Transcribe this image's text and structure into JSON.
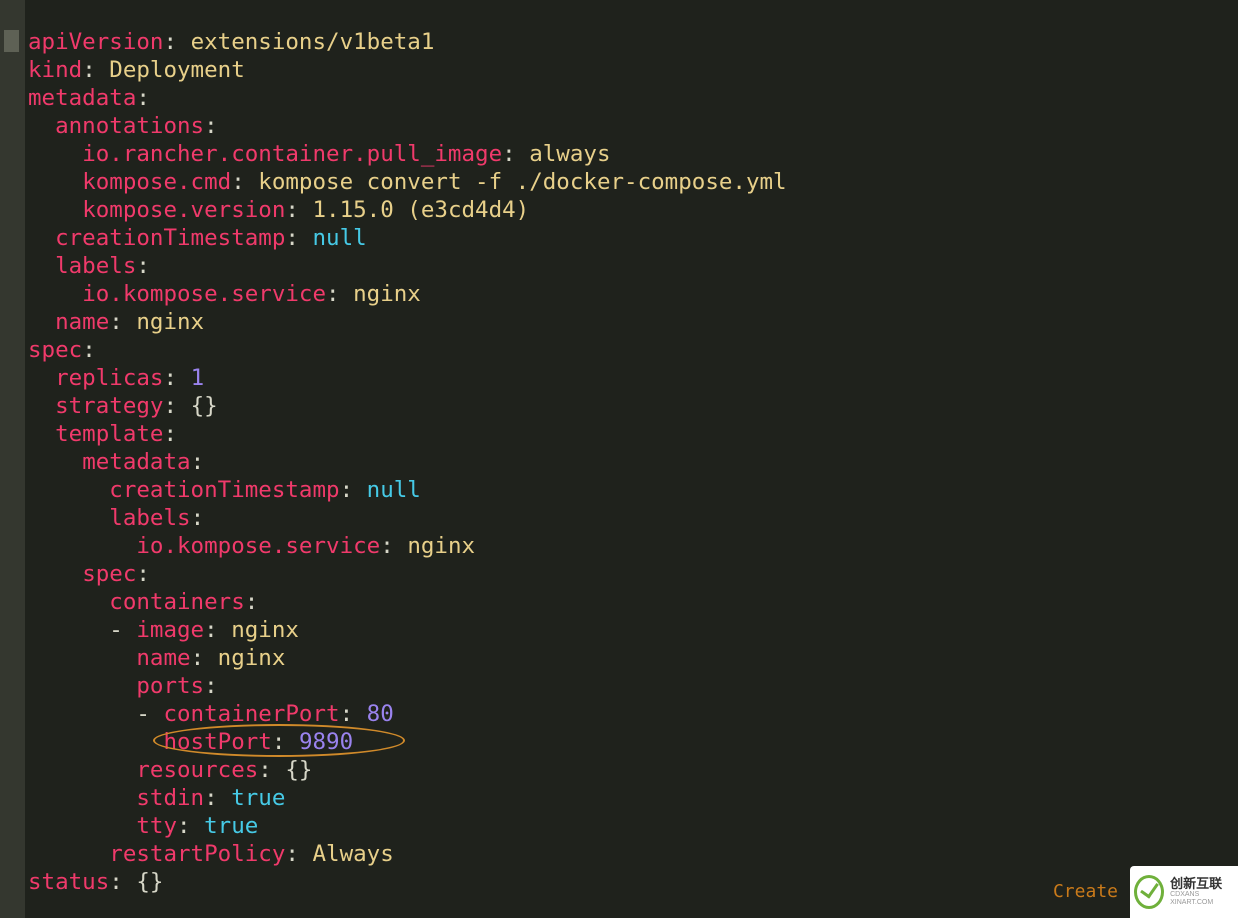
{
  "code": {
    "apiVersion_key": "apiVersion",
    "apiVersion_val": "extensions/v1beta1",
    "kind_key": "kind",
    "kind_val": "Deployment",
    "metadata_key": "metadata",
    "annotations_key": "annotations",
    "anno1_key": "io.rancher.container.pull_image",
    "anno1_val": "always",
    "anno2_key": "kompose.cmd",
    "anno2_val": "kompose convert -f ./docker-compose.yml",
    "anno3_key": "kompose.version",
    "anno3_val": "1.15.0 (e3cd4d4)",
    "creationTimestamp_key": "creationTimestamp",
    "creationTimestamp_val": "null",
    "labels_key": "labels",
    "label1_key": "io.kompose.service",
    "label1_val": "nginx",
    "name_key": "name",
    "name_val": "nginx",
    "spec_key": "spec",
    "replicas_key": "replicas",
    "replicas_val": "1",
    "strategy_key": "strategy",
    "strategy_val": "{}",
    "template_key": "template",
    "tpl_metadata_key": "metadata",
    "tpl_creationTimestamp_key": "creationTimestamp",
    "tpl_creationTimestamp_val": "null",
    "tpl_labels_key": "labels",
    "tpl_label1_key": "io.kompose.service",
    "tpl_label1_val": "nginx",
    "tpl_spec_key": "spec",
    "containers_key": "containers",
    "image_key": "image",
    "image_val": "nginx",
    "cname_key": "name",
    "cname_val": "nginx",
    "ports_key": "ports",
    "containerPort_key": "containerPort",
    "containerPort_val": "80",
    "hostPort_key": "hostPort",
    "hostPort_val": "9890",
    "resources_key": "resources",
    "resources_val": "{}",
    "stdin_key": "stdin",
    "stdin_val": "true",
    "tty_key": "tty",
    "tty_val": "true",
    "restartPolicy_key": "restartPolicy",
    "restartPolicy_val": "Always",
    "status_key": "status",
    "status_val": "{}"
  },
  "footer": {
    "link": "Create",
    "logo_main": "创新互联",
    "logo_sub": "CDXANS XINART.COM"
  }
}
